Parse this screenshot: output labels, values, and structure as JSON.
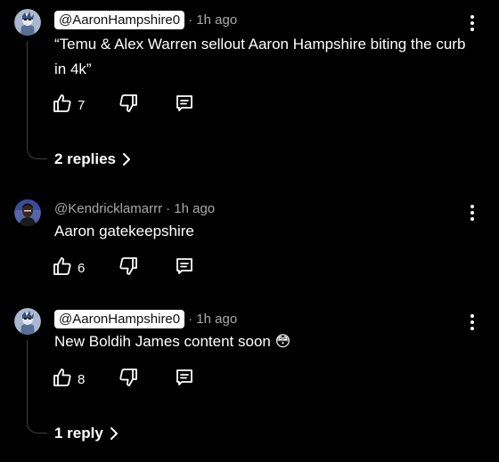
{
  "comments": [
    {
      "handle": "@AaronHampshire0",
      "handle_style": "highlighted",
      "timestamp": "· 1h ago",
      "text": "“Temu & Alex Warren sellout Aaron Hampshire biting the curb in 4k”",
      "likes": "7",
      "replies_label": "2 replies",
      "avatar": "cartoon-avatar"
    },
    {
      "handle": "@Kendricklamarrr",
      "handle_style": "plain",
      "timestamp": "· 1h ago",
      "text": "Aaron gatekeepshire",
      "likes": "6",
      "avatar": "photo-avatar"
    },
    {
      "handle": "@AaronHampshire0",
      "handle_style": "highlighted",
      "timestamp": "· 1h ago",
      "text": "New Boldih James content soon 😳",
      "likes": "8",
      "replies_label": "1 reply",
      "avatar": "cartoon-avatar"
    }
  ],
  "icons": {
    "like": "thumbs-up-icon",
    "dislike": "thumbs-down-icon",
    "reply": "reply-comment-icon",
    "more": "more-vertical-icon",
    "expand": "chevron-right-icon"
  },
  "colors": {
    "background": "#000000",
    "text": "#ffffff",
    "secondary_text": "#aaaaaa",
    "handle_chip": "#ffffff",
    "thread_line": "#3f3f3f"
  }
}
